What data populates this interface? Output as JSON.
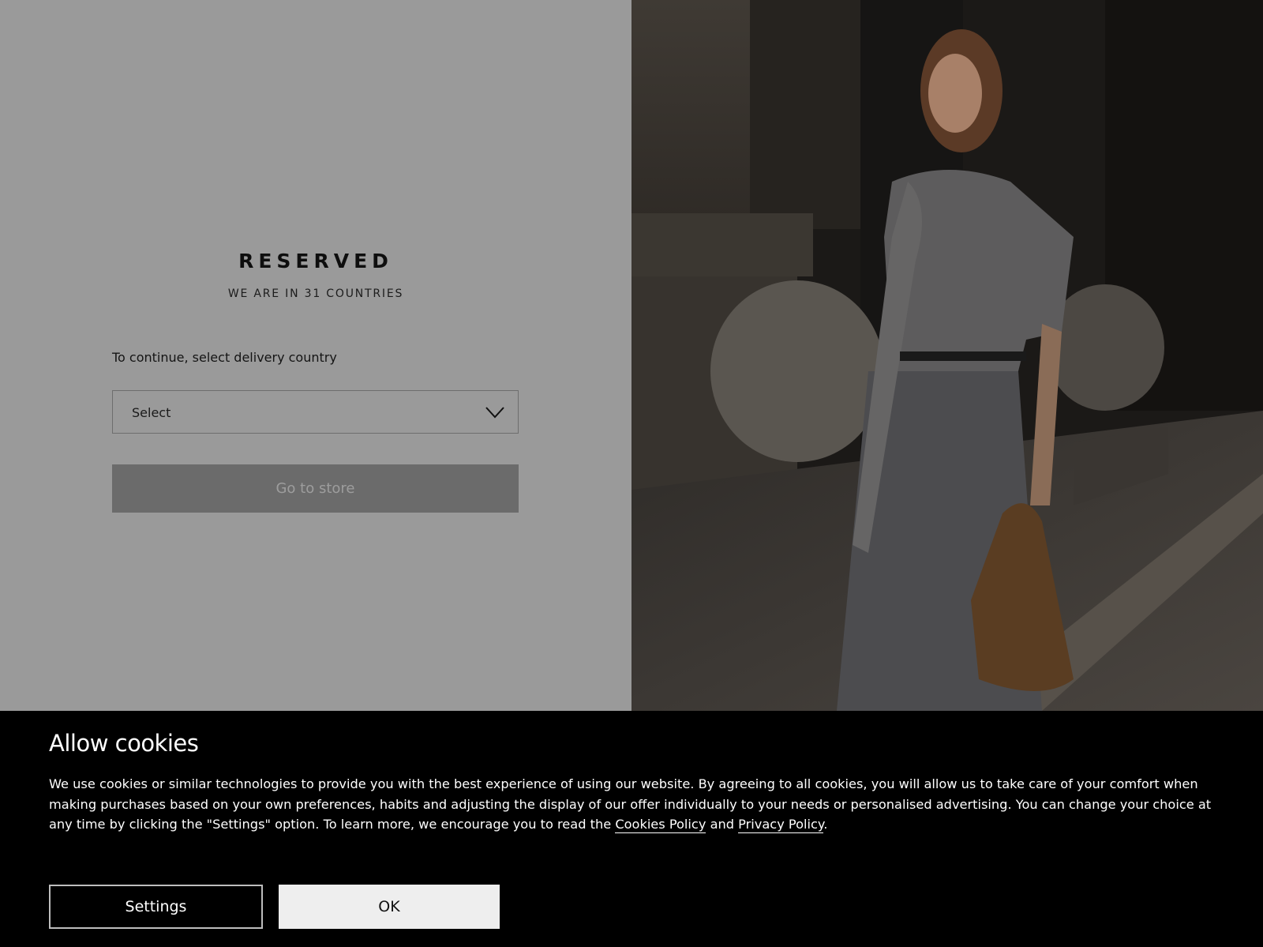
{
  "country_selector": {
    "brand": "RESERVED",
    "tagline": "WE ARE IN 31 COUNTRIES",
    "prompt": "To continue, select delivery country",
    "select_value": "Select",
    "go_button": "Go to store"
  },
  "cookie_banner": {
    "title": "Allow cookies",
    "text_before": "We use cookies or similar technologies to provide you with the best experience of using our website. By agreeing to all cookies, you will allow us to take care of your comfort when making purchases based on your own preferences, habits and adjusting the display of our offer individually to your needs or personalised advertising. You can change your choice at any time by clicking the \"Settings\" option. To learn more, we encourage you to read the ",
    "cookies_policy_link": "Cookies Policy",
    "and_text": " and ",
    "privacy_policy_link": "Privacy Policy",
    "end_text": ".",
    "settings_button": "Settings",
    "ok_button": "OK"
  },
  "colors": {
    "overlay_panel": "#9a9a9a",
    "banner_bg": "#000000",
    "go_button_bg": "#6b6b6b",
    "ok_button_bg": "#eeeeee"
  }
}
